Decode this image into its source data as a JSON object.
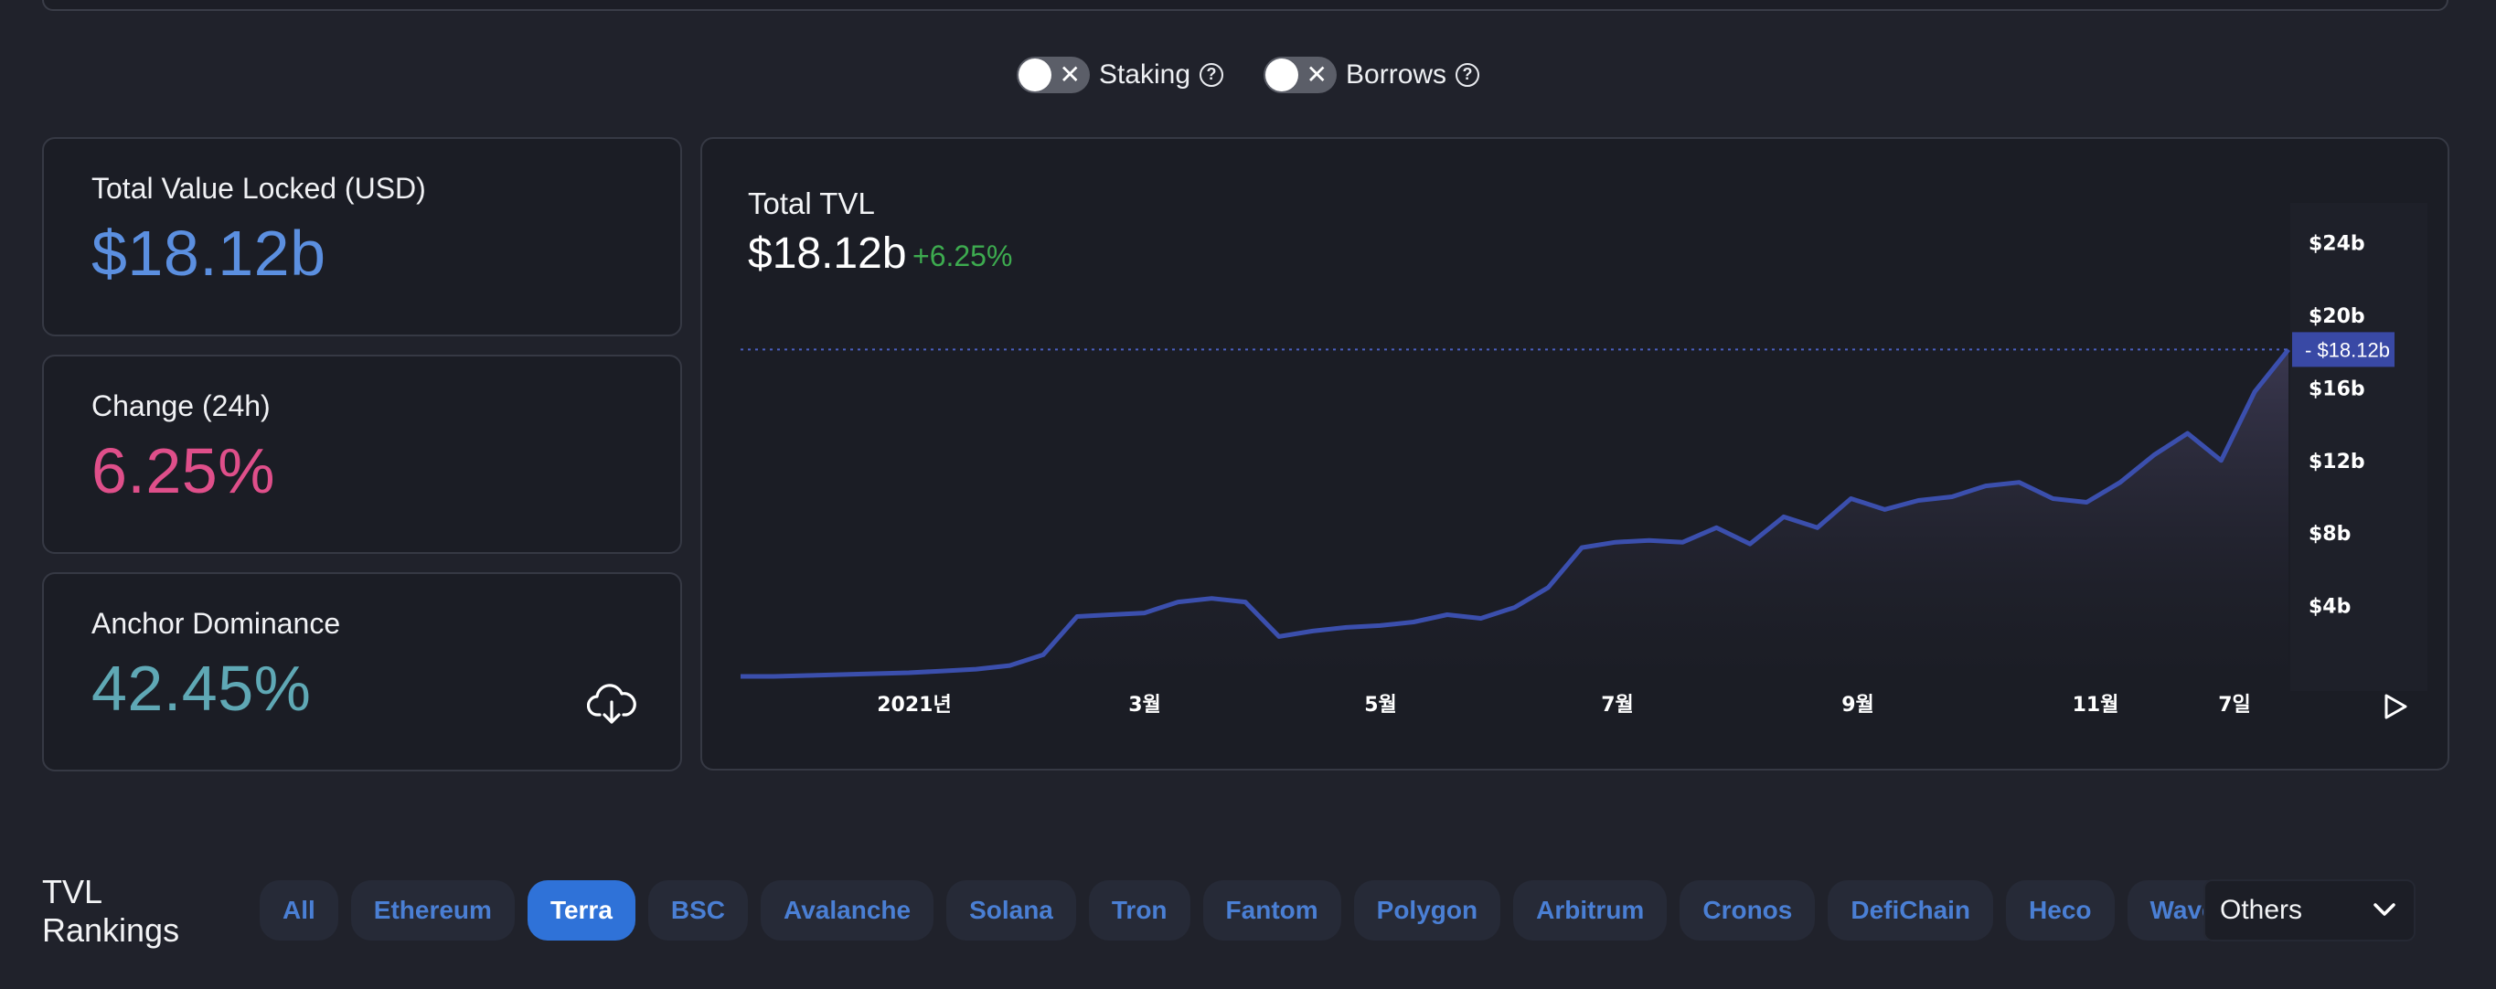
{
  "toggles": [
    {
      "label": "Staking",
      "state": "off"
    },
    {
      "label": "Borrows",
      "state": "off"
    }
  ],
  "stats": [
    {
      "label": "Total Value Locked (USD)",
      "value": "$18.12b",
      "color": "#5b8fe0"
    },
    {
      "label": "Change (24h)",
      "value": "6.25%",
      "color": "#df4f8a"
    },
    {
      "label": "Anchor Dominance",
      "value": "42.45%",
      "color": "#5fa8b5"
    }
  ],
  "chart": {
    "title": "Total TVL",
    "value": "$18.12b",
    "change": "+6.25%",
    "current_label": "$18.12b"
  },
  "chart_data": {
    "type": "area",
    "y_ticks": [
      "$4b",
      "$8b",
      "$12b",
      "$16b",
      "$20b",
      "$24b"
    ],
    "ylim": [
      0,
      26
    ],
    "x_ticks": [
      "2021년",
      "3월",
      "5월",
      "7월",
      "9월",
      "11월",
      "7일"
    ],
    "current_value": 18.12,
    "series": [
      {
        "values": [
          0.1,
          0.1,
          0.15,
          0.2,
          0.25,
          0.3,
          0.4,
          0.5,
          0.7,
          1.3,
          3.4,
          3.5,
          3.6,
          4.2,
          4.4,
          4.2,
          2.3,
          2.6,
          2.8,
          2.9,
          3.1,
          3.5,
          3.3,
          3.9,
          5.0,
          7.2,
          7.5,
          7.6,
          7.5,
          8.3,
          7.4,
          8.9,
          8.3,
          9.9,
          9.3,
          9.8,
          10.0,
          10.6,
          10.8,
          9.9,
          9.7,
          10.8,
          12.3,
          13.5,
          12.0,
          15.8,
          18.12
        ]
      }
    ]
  },
  "rankings": {
    "title_line1": "TVL",
    "title_line2": "Rankings",
    "chains": [
      "All",
      "Ethereum",
      "Terra",
      "BSC",
      "Avalanche",
      "Solana",
      "Tron",
      "Fantom",
      "Polygon",
      "Arbitrum",
      "Cronos",
      "DefiChain",
      "Heco",
      "Waves"
    ],
    "active": "Terra",
    "others_label": "Others"
  }
}
